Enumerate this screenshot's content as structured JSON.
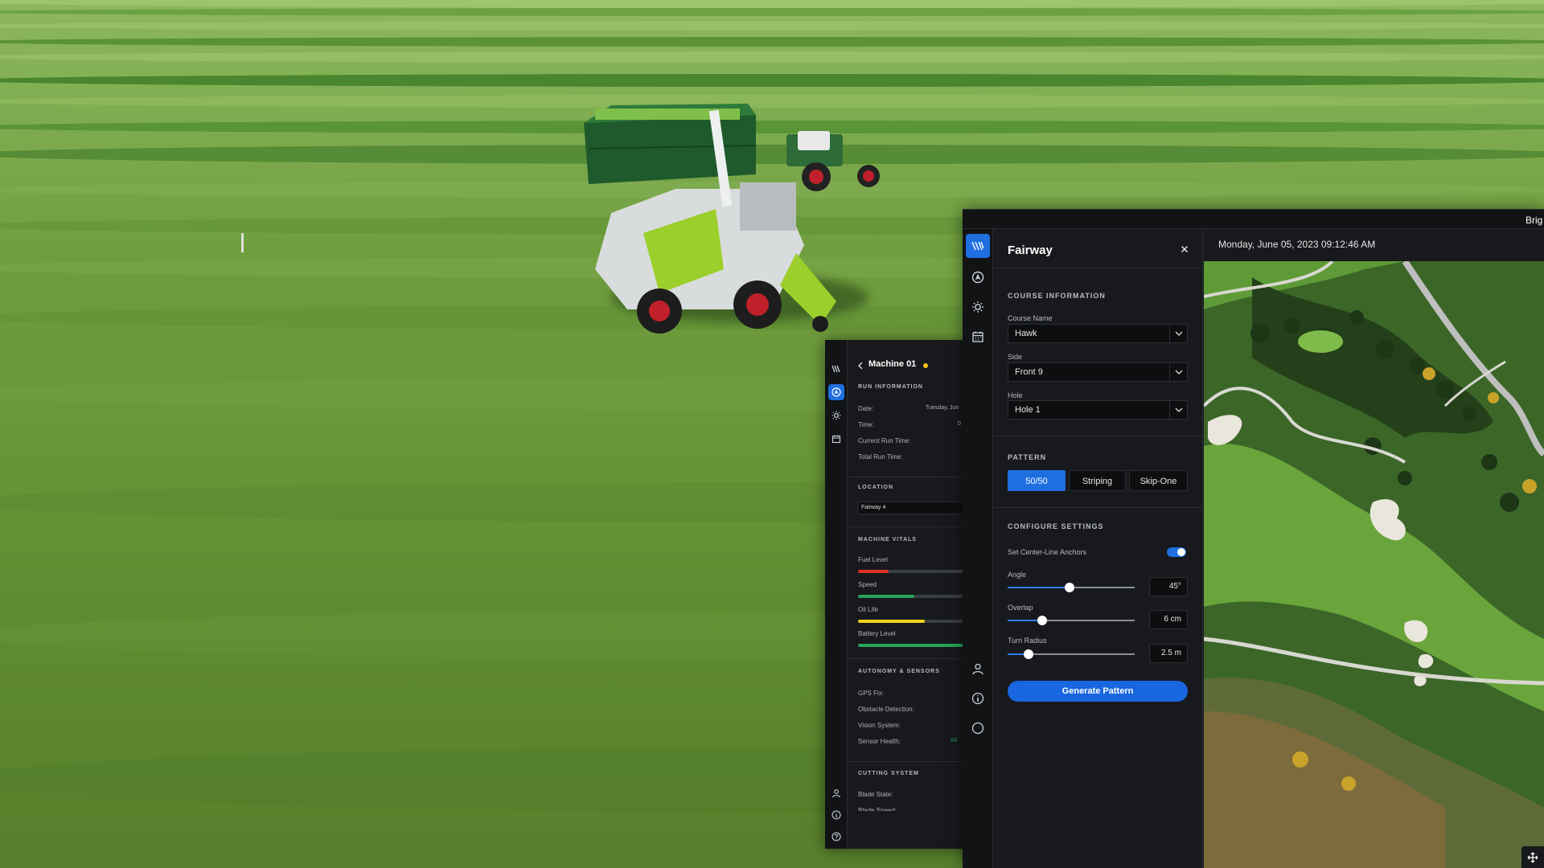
{
  "background": {
    "description_colors": {
      "grass": "#6a9738",
      "stripe_dark": "#4f8a2c",
      "stripe_light": "#9cc46a"
    }
  },
  "machine_panel": {
    "title": "Machine 01",
    "status_color": "#f5c518",
    "run_information": {
      "heading": "RUN INFORMATION",
      "rows": [
        {
          "label": "Date:",
          "value": "Tuesday, Jun"
        },
        {
          "label": "Time:",
          "value": "0"
        },
        {
          "label": "Current Run Time:",
          "value": ""
        },
        {
          "label": "Total Run Time:",
          "value": ""
        }
      ]
    },
    "location": {
      "heading": "LOCATION",
      "value": "Fairway 4"
    },
    "machine_vitals": {
      "heading": "MACHINE VITALS",
      "bars": [
        {
          "label": "Fuel Level",
          "level": 0.27,
          "color": "#e0302a"
        },
        {
          "label": "Speed",
          "level": 0.5,
          "color": "#27a35a"
        },
        {
          "label": "Oil Life",
          "level": 0.6,
          "color": "#f2d21b"
        },
        {
          "label": "Battery Level",
          "level": 0.98,
          "color": "#27a35a"
        }
      ]
    },
    "autonomy": {
      "heading": "AUTONOMY & SENSORS",
      "rows": [
        {
          "label": "GPS Fix:",
          "value": ""
        },
        {
          "label": "Obstacle Detection:",
          "value": ""
        },
        {
          "label": "Vision System:",
          "value": ""
        },
        {
          "label": "Sensor Health:",
          "value": "All"
        }
      ]
    },
    "cutting": {
      "heading": "CUTTING SYSTEM",
      "rows": [
        {
          "label": "Blade State:"
        },
        {
          "label": "Blade Speed:"
        }
      ]
    },
    "rail_icons": [
      "pattern-icon",
      "navigation-icon",
      "sun-icon",
      "calendar-icon",
      "user-icon",
      "info-icon",
      "help-icon"
    ]
  },
  "fairway_panel": {
    "title": "Fairway",
    "timestamp": "Monday, June 05, 2023 09:12:46 AM",
    "top_right_text": "Brig",
    "course_information": {
      "heading": "COURSE INFORMATION",
      "course_name": {
        "label": "Course Name",
        "value": "Hawk"
      },
      "side": {
        "label": "Side",
        "value": "Front 9"
      },
      "hole": {
        "label": "Hole",
        "value": "Hole 1"
      }
    },
    "pattern": {
      "heading": "PATTERN",
      "options": [
        "50/50",
        "Striping",
        "Skip-One"
      ],
      "selected": "50/50"
    },
    "configure": {
      "heading": "CONFIGURE SETTINGS",
      "anchors_label": "Set Center-Line Anchors",
      "anchors_on": true,
      "sliders": [
        {
          "label": "Angle",
          "value": "45°",
          "level": 0.49
        },
        {
          "label": "Overlap",
          "value": "6 cm",
          "level": 0.27
        },
        {
          "label": "Turn Radius",
          "value": "2.5 m",
          "level": 0.16
        }
      ]
    },
    "generate_label": "Generate Pattern",
    "rail_icons": [
      "pattern-icon",
      "navigation-icon",
      "sun-icon",
      "calendar-icon",
      "user-icon",
      "info-icon",
      "help-icon"
    ],
    "accent": "#1f6fe0"
  }
}
